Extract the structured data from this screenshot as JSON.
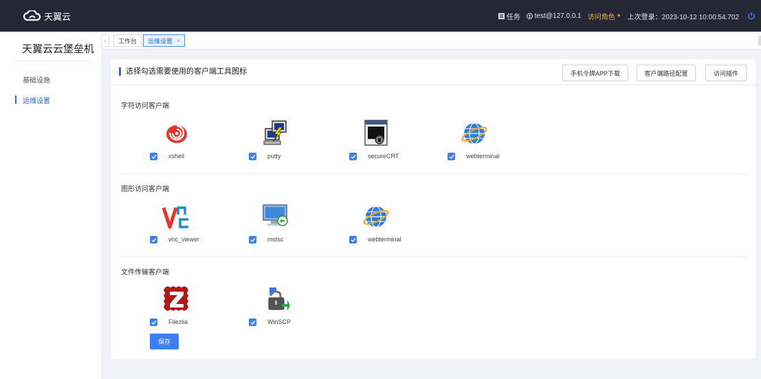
{
  "app": {
    "logo_text": "天翼云",
    "system_title": "天翼云云堡垒机"
  },
  "topbar": {
    "tasks": "任务",
    "user": "test@127.0.0.1",
    "role": "访问角色",
    "last_login": "上次登录：2023-10-12 10:00:54.702"
  },
  "sidebar": {
    "items": [
      {
        "label": "基础设施"
      },
      {
        "label": "运维设置"
      }
    ]
  },
  "tabs": [
    {
      "label": "工作台"
    },
    {
      "label": "运维设置",
      "close": "×"
    }
  ],
  "card": {
    "title": "选择勾选需要使用的客户端工具图标",
    "buttons": {
      "app_download": "手机令牌APP下载",
      "client_path": "客户端路径配置",
      "access_plugin": "访问插件"
    }
  },
  "sections": {
    "char": {
      "title": "字符访问客户端",
      "tools": [
        {
          "label": "xshell",
          "icon": "xshell-icon"
        },
        {
          "label": "putty",
          "icon": "putty-icon"
        },
        {
          "label": "secureCRT",
          "icon": "securecrt-icon"
        },
        {
          "label": "webterminal",
          "icon": "globe-icon"
        }
      ]
    },
    "graphic": {
      "title": "图形访问客户端",
      "tools": [
        {
          "label": "vnc_viewer",
          "icon": "vnc-icon"
        },
        {
          "label": "mstsc",
          "icon": "mstsc-icon"
        },
        {
          "label": "webterminal",
          "icon": "globe-icon"
        }
      ]
    },
    "file": {
      "title": "文件传输客户端",
      "tools": [
        {
          "label": "Filezila",
          "icon": "filezilla-icon"
        },
        {
          "label": "WinSCP",
          "icon": "winscp-icon"
        }
      ]
    }
  },
  "save_label": "保存",
  "colors": {
    "primary": "#3b7ff3",
    "topbar": "#252834",
    "role": "#f5a623"
  }
}
